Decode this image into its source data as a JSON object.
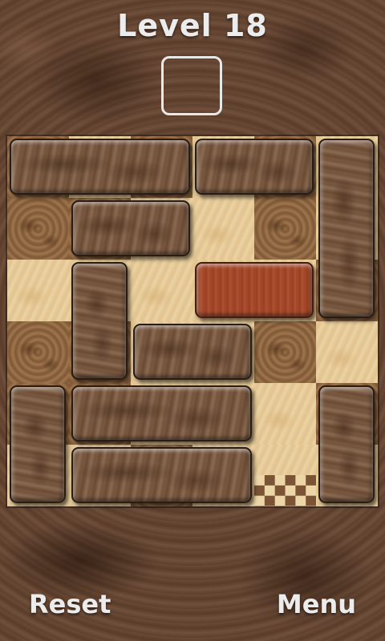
{
  "header": {
    "title": "Level 18",
    "moves_display": ""
  },
  "board": {
    "grid_size": 6,
    "blocks": [
      {
        "id": "block-1",
        "orientation": "horizontal",
        "row": 1,
        "col": 1,
        "length": 3,
        "color": "wood"
      },
      {
        "id": "block-2",
        "orientation": "horizontal",
        "row": 1,
        "col": 4,
        "length": 2,
        "color": "wood"
      },
      {
        "id": "block-3",
        "orientation": "vertical",
        "row": 1,
        "col": 6,
        "length": 3,
        "color": "wood"
      },
      {
        "id": "block-4",
        "orientation": "horizontal",
        "row": 2,
        "col": 2,
        "length": 2,
        "color": "wood"
      },
      {
        "id": "block-5",
        "orientation": "vertical",
        "row": 3,
        "col": 2,
        "length": 2,
        "color": "wood"
      },
      {
        "id": "target-block",
        "orientation": "horizontal",
        "row": 3,
        "col": 4,
        "length": 2,
        "color": "red"
      },
      {
        "id": "block-6",
        "orientation": "horizontal",
        "row": 4,
        "col": 3,
        "length": 2,
        "color": "wood"
      },
      {
        "id": "block-7",
        "orientation": "vertical",
        "row": 5,
        "col": 1,
        "length": 2,
        "color": "wood"
      },
      {
        "id": "block-8",
        "orientation": "horizontal",
        "row": 5,
        "col": 2,
        "length": 3,
        "color": "wood"
      },
      {
        "id": "block-9",
        "orientation": "vertical",
        "row": 5,
        "col": 6,
        "length": 2,
        "color": "wood"
      },
      {
        "id": "block-10",
        "orientation": "horizontal",
        "row": 6,
        "col": 2,
        "length": 3,
        "color": "wood"
      }
    ],
    "exit": {
      "row": 6,
      "col": 5
    }
  },
  "footer": {
    "reset_label": "Reset",
    "menu_label": "Menu"
  }
}
